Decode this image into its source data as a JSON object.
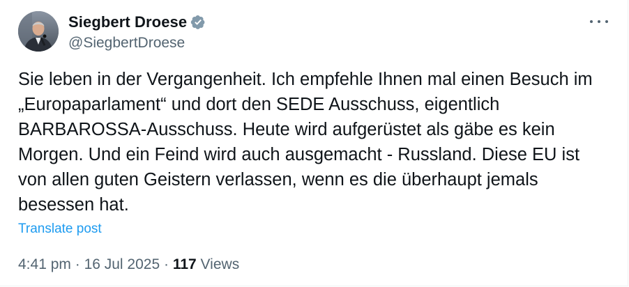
{
  "author": {
    "display_name": "Siegbert Droese",
    "handle": "@SiegbertDroese",
    "verified": true,
    "verified_color": "#1d9bf0"
  },
  "post": {
    "text": "Sie leben in der Vergangenheit. Ich empfehle Ihnen mal einen Besuch im\n„Europaparlament“ und dort den SEDE Ausschuss, eigentlich\nBARBAROSSA-Ausschuss. Heute wird aufgerüstet als gäbe es kein\nMorgen. Und ein Feind wird auch ausgemacht - Russland. Diese EU ist\nvon allen guten Geistern verlassen, wenn es die überhaupt jemals\nbesessen hat.",
    "translate_label": "Translate post"
  },
  "meta": {
    "time": "4:41 pm",
    "separator": " · ",
    "date": "16 Jul 2025",
    "views_count": "117",
    "views_label": " Views"
  },
  "icons": {
    "more": "more-horizontal-icon",
    "verified": "verified-badge-icon"
  },
  "colors": {
    "link": "#1d9bf0",
    "secondary_text": "#536471",
    "primary_text": "#0f1419"
  }
}
